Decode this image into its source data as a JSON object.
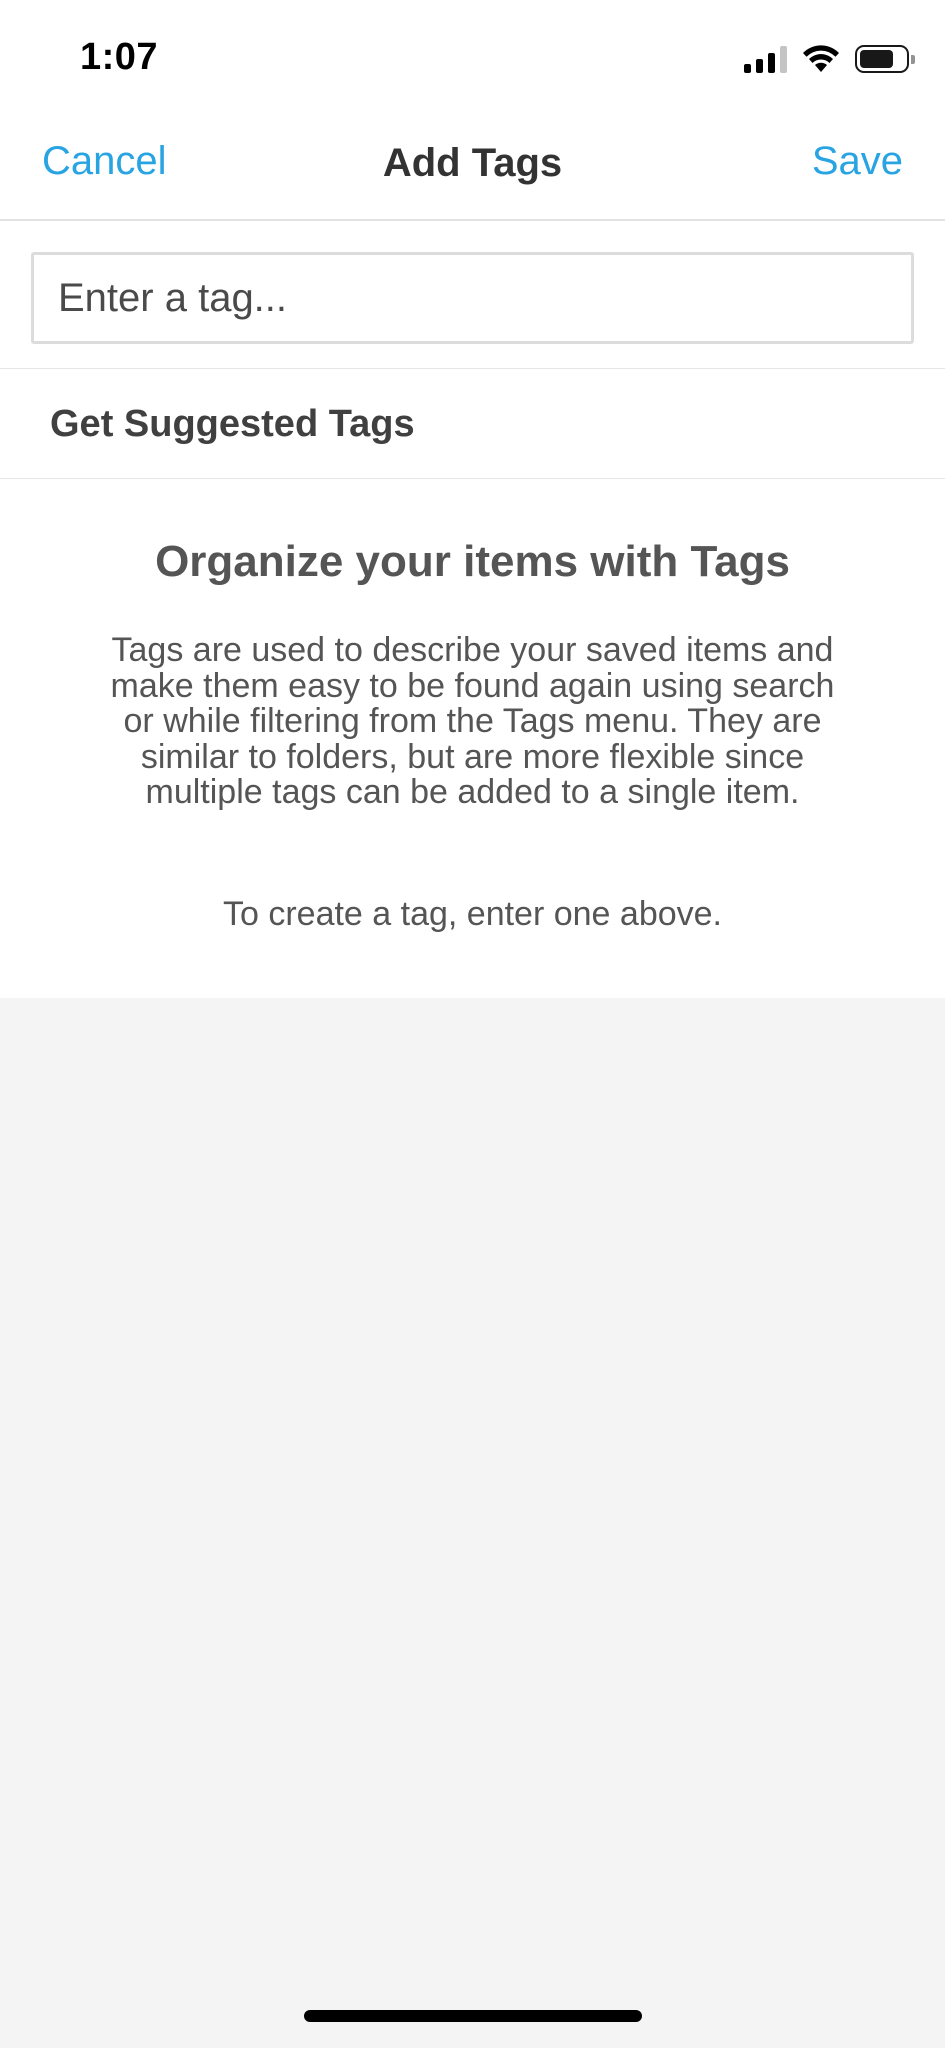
{
  "status_bar": {
    "time": "1:07",
    "icons": [
      "cellular-signal-icon",
      "wifi-icon",
      "battery-icon"
    ]
  },
  "nav": {
    "cancel_label": "Cancel",
    "title": "Add Tags",
    "save_label": "Save",
    "accent_color": "#29a4e3"
  },
  "tag_input": {
    "value": "",
    "placeholder": "Enter a tag..."
  },
  "suggested": {
    "label": "Get Suggested Tags"
  },
  "empty_state": {
    "title": "Organize your items with Tags",
    "body": "Tags are used to describe your saved items and make them easy to be found again using search or while filtering from the Tags menu. They are similar to folders, but are more flexible since multiple tags can be added to a single item.",
    "hint": "To create a tag, enter one above."
  }
}
